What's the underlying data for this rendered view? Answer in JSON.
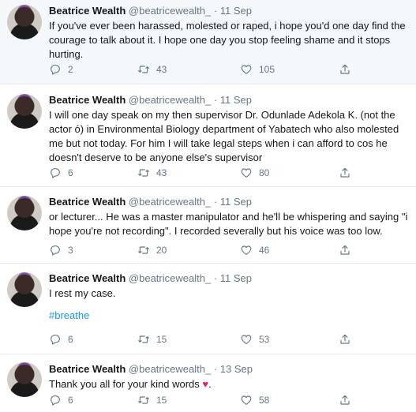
{
  "tweets": [
    {
      "name": "Beatrice Wealth",
      "handle": "@beatricewealth_",
      "dot": "·",
      "date": "11 Sep",
      "text": "If you've ever been harassed, molested or raped, i hope you'd one day find the courage to talk about it. I hope one day you stop feeling shame and it stops hurting.",
      "replies": "2",
      "retweets": "43",
      "likes": "105"
    },
    {
      "name": "Beatrice Wealth",
      "handle": "@beatricewealth_",
      "dot": "·",
      "date": "11 Sep",
      "text": "I will one day speak on my then supervisor Dr. Odunlade Adekola K. (not the actor ó) in Environmental Biology department of Yabatech  who also molested me but not today. For him I will take legal steps when i can afford to cos he doesn't deserve to be anyone else's supervisor",
      "replies": "6",
      "retweets": "43",
      "likes": "80"
    },
    {
      "name": "Beatrice Wealth",
      "handle": "@beatricewealth_",
      "dot": "·",
      "date": "11 Sep",
      "text": "or lecturer... He was a master manipulator and he'll be whispering and saying \"i hope you're not recording\". I recorded severally but his voice was too low.",
      "replies": "3",
      "retweets": "20",
      "likes": "46"
    },
    {
      "name": "Beatrice Wealth",
      "handle": "@beatricewealth_",
      "dot": "·",
      "date": "11 Sep",
      "text": "I rest my case.",
      "hashtag": "#breathe",
      "replies": "6",
      "retweets": "15",
      "likes": "53"
    },
    {
      "name": "Beatrice Wealth",
      "handle": "@beatricewealth_",
      "dot": "·",
      "date": "13 Sep",
      "text": "Thank you all for your kind words",
      "emoji": "♥",
      "emoji_suffix": ".",
      "replies": "6",
      "retweets": "15",
      "likes": "58"
    }
  ],
  "icons": {
    "reply": "reply-icon",
    "retweet": "retweet-icon",
    "like": "heart-icon",
    "share": "share-icon"
  },
  "colors": {
    "name": "#14171a",
    "secondary": "#657786",
    "link": "#1b95e0",
    "highlight_bg": "#f5f8fa",
    "divider": "#e6ecf0",
    "emoji_red": "#e0245e"
  }
}
